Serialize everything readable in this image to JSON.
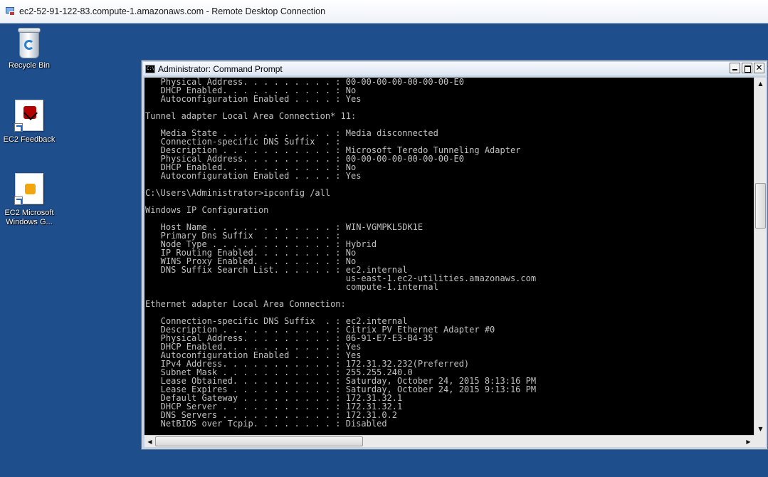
{
  "rdp": {
    "title": "ec2-52-91-122-83.compute-1.amazonaws.com - Remote Desktop Connection"
  },
  "desktop": {
    "icons": [
      {
        "label": "Recycle Bin",
        "icon": "recycle-bin-icon"
      },
      {
        "label": "EC2 Feedback",
        "icon": "ec2-feedback-icon"
      },
      {
        "label": "EC2 Microsoft Windows G...",
        "icon": "ec2-windows-guide-icon"
      }
    ]
  },
  "cmd": {
    "title": "Administrator: Command Prompt",
    "icon_text": "C:\\",
    "close_glyph": "✕",
    "lines": [
      "   Physical Address. . . . . . . . . : 00-00-00-00-00-00-00-E0",
      "   DHCP Enabled. . . . . . . . . . . : No",
      "   Autoconfiguration Enabled . . . . : Yes",
      "",
      "Tunnel adapter Local Area Connection* 11:",
      "",
      "   Media State . . . . . . . . . . . : Media disconnected",
      "   Connection-specific DNS Suffix  . :",
      "   Description . . . . . . . . . . . : Microsoft Teredo Tunneling Adapter",
      "   Physical Address. . . . . . . . . : 00-00-00-00-00-00-00-E0",
      "   DHCP Enabled. . . . . . . . . . . : No",
      "   Autoconfiguration Enabled . . . . : Yes",
      "",
      "C:\\Users\\Administrator>ipconfig /all",
      "",
      "Windows IP Configuration",
      "",
      "   Host Name . . . . . . . . . . . . : WIN-VGMPKL5DK1E",
      "   Primary Dns Suffix  . . . . . . . :",
      "   Node Type . . . . . . . . . . . . : Hybrid",
      "   IP Routing Enabled. . . . . . . . : No",
      "   WINS Proxy Enabled. . . . . . . . : No",
      "   DNS Suffix Search List. . . . . . : ec2.internal",
      "                                       us-east-1.ec2-utilities.amazonaws.com",
      "                                       compute-1.internal",
      "",
      "Ethernet adapter Local Area Connection:",
      "",
      "   Connection-specific DNS Suffix  . : ec2.internal",
      "   Description . . . . . . . . . . . : Citrix PV Ethernet Adapter #0",
      "   Physical Address. . . . . . . . . : 06-91-E7-E3-B4-35",
      "   DHCP Enabled. . . . . . . . . . . : Yes",
      "   Autoconfiguration Enabled . . . . : Yes",
      "   IPv4 Address. . . . . . . . . . . : 172.31.32.232(Preferred)",
      "   Subnet Mask . . . . . . . . . . . : 255.255.240.0",
      "   Lease Obtained. . . . . . . . . . : Saturday, October 24, 2015 8:13:16 PM",
      "   Lease Expires . . . . . . . . . . : Saturday, October 24, 2015 9:13:16 PM",
      "   Default Gateway . . . . . . . . . : 172.31.32.1",
      "   DHCP Server . . . . . . . . . . . : 172.31.32.1",
      "   DNS Servers . . . . . . . . . . . : 172.31.0.2",
      "   NetBIOS over Tcpip. . . . . . . . : Disabled"
    ]
  }
}
